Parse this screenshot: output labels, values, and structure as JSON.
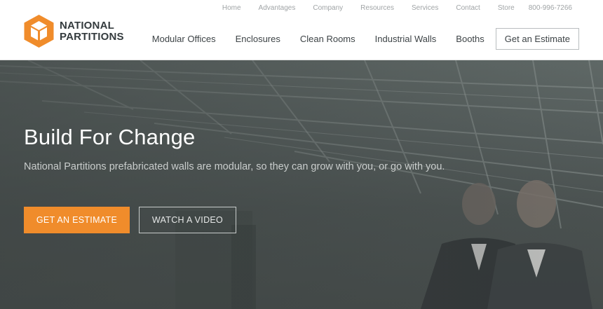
{
  "brand": {
    "name_line1": "NATIONAL",
    "name_line2": "PARTITIONS",
    "accent": "#f08c2b"
  },
  "utility_nav": [
    "Home",
    "Advantages",
    "Company",
    "Resources",
    "Services",
    "Contact",
    "Store"
  ],
  "phone": "800-996-7266",
  "main_nav": [
    "Modular Offices",
    "Enclosures",
    "Clean Rooms",
    "Industrial Walls",
    "Booths"
  ],
  "header_cta": "Get an Estimate",
  "hero": {
    "title": "Build For Change",
    "subtitle": "National Partitions prefabricated walls are modular, so they can grow with you, or go with you.",
    "primary_cta": "GET AN ESTIMATE",
    "secondary_cta": "WATCH A VIDEO"
  }
}
